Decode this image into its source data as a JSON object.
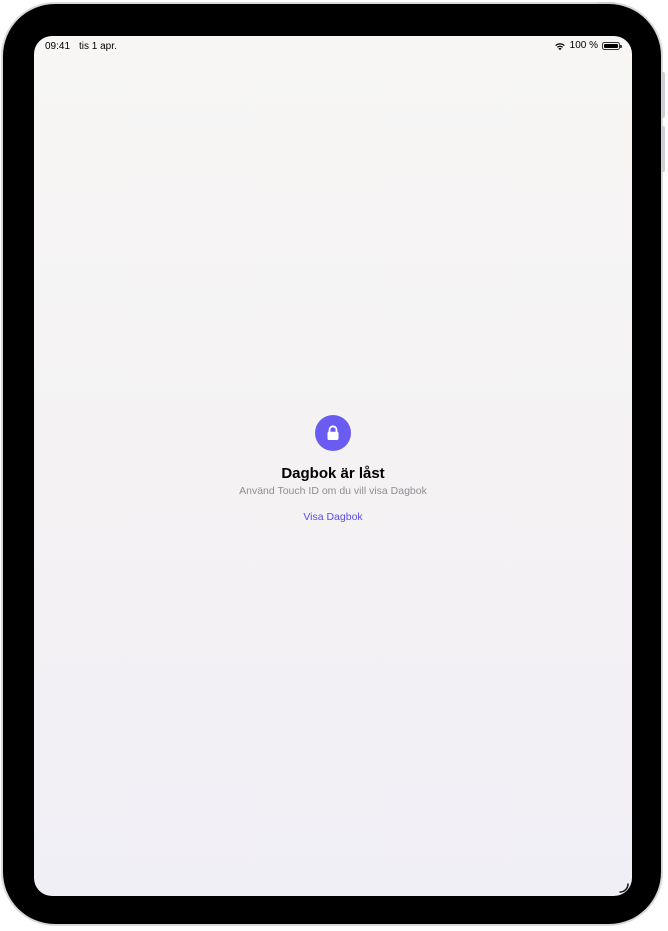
{
  "status_bar": {
    "time": "09:41",
    "date": "tis 1 apr.",
    "battery_text": "100 %",
    "wifi_icon": "wifi-icon",
    "battery_icon": "battery-icon"
  },
  "lock_screen": {
    "icon": "lock-icon",
    "title": "Dagbok är låst",
    "subtitle": "Använd Touch ID om du vill visa Dagbok",
    "action_label": "Visa Dagbok",
    "accent_color": "#6a5cf0"
  }
}
